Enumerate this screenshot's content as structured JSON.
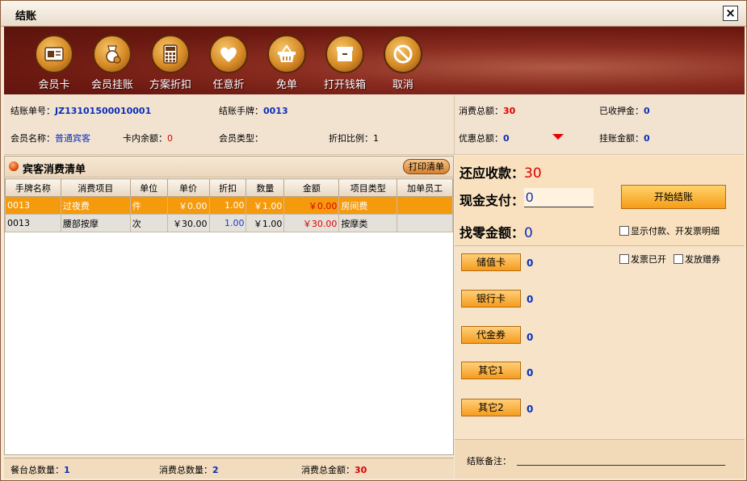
{
  "window": {
    "title": "结账"
  },
  "toolbar": {
    "buttons": [
      {
        "label": "会员卡",
        "icon": "member-card-icon"
      },
      {
        "label": "会员挂账",
        "icon": "member-credit-icon"
      },
      {
        "label": "方案折扣",
        "icon": "calculator-icon"
      },
      {
        "label": "任意折",
        "icon": "heart-icon"
      },
      {
        "label": "免单",
        "icon": "basket-icon"
      },
      {
        "label": "打开钱箱",
        "icon": "cash-box-icon"
      },
      {
        "label": "取消",
        "icon": "cancel-icon"
      }
    ]
  },
  "info": {
    "bill_no_label": "结账单号：",
    "bill_no": "JZ13101500010001",
    "tag_label": "结账手牌：",
    "tag": "0013",
    "member_name_label": "会员名称：",
    "member_name": "普通宾客",
    "card_balance_label": "卡内余额：",
    "card_balance": "0",
    "member_type_label": "会员类型：",
    "member_type": "",
    "discount_ratio_label": "折扣比例：",
    "discount_ratio": "1",
    "total_consume_label": "消费总额：",
    "total_consume": "30",
    "deposit_label": "已收押金：",
    "deposit": "0",
    "total_discount_label": "优惠总额：",
    "total_discount": "0",
    "credit_label": "挂账金额：",
    "credit": "0"
  },
  "list": {
    "title": "宾客消费清单",
    "print_label": "打印清单",
    "columns": [
      "手牌名称",
      "消费项目",
      "单位",
      "单价",
      "折扣",
      "数量",
      "金额",
      "项目类型",
      "加单员工"
    ],
    "rows": [
      {
        "tag": "0013",
        "item": "过夜费",
        "unit": "件",
        "price": "￥0.00",
        "discount": "1.00",
        "qty": "￥1.00",
        "amount": "￥0.00",
        "type": "房间费",
        "staff": ""
      },
      {
        "tag": "0013",
        "item": "腰部按摩",
        "unit": "次",
        "price": "￥30.00",
        "discount": "1.00",
        "qty": "￥1.00",
        "amount": "￥30.00",
        "type": "按摩类",
        "staff": ""
      }
    ]
  },
  "footer": {
    "table_count_label": "餐台总数量：",
    "table_count": "1",
    "consume_count_label": "消费总数量：",
    "consume_count": "2",
    "consume_amount_label": "消费总金额：",
    "consume_amount": "30"
  },
  "payment": {
    "receivable_label": "还应收款：",
    "receivable": "30",
    "cash_label": "现金支付：",
    "cash_value": "0",
    "start_label": "开始结账",
    "change_label": "找零金额：",
    "change": "0",
    "show_detail_label": "显示付款、开发票明细",
    "invoice_label": "发票已开",
    "coupon_label": "发放赠券",
    "methods": [
      {
        "label": "储值卡",
        "value": "0"
      },
      {
        "label": "银行卡",
        "value": "0"
      },
      {
        "label": "代金券",
        "value": "0"
      },
      {
        "label": "其它1",
        "value": "0"
      },
      {
        "label": "其它2",
        "value": "0"
      }
    ],
    "note_label": "结账备注："
  },
  "colors": {
    "accent": "#f59a0c",
    "value_blue": "#0a2fb8",
    "value_red": "#d00000",
    "toolbar_bg": "#7a1c12"
  }
}
